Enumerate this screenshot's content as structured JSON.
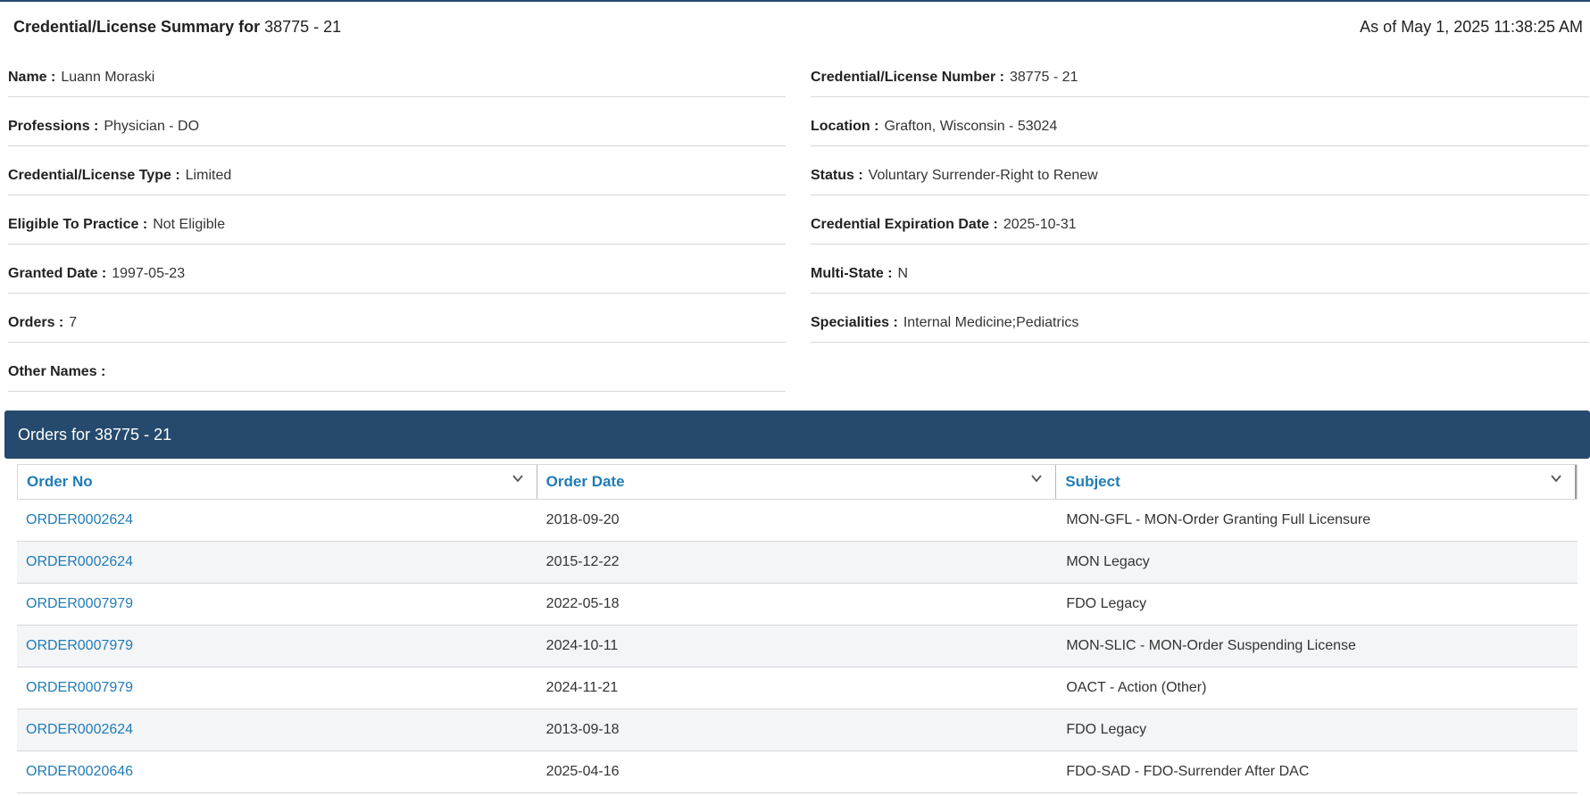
{
  "summary": {
    "title_label": "Credential/License Summary for",
    "title_value": "38775 - 21",
    "as_of": "As of May 1, 2025 11:38:25 AM"
  },
  "fields_left": [
    {
      "label": "Name :",
      "value": "Luann Moraski"
    },
    {
      "label": "Professions :",
      "value": "Physician - DO"
    },
    {
      "label": "Credential/License Type :",
      "value": "Limited"
    },
    {
      "label": "Eligible To Practice :",
      "value": "Not Eligible"
    },
    {
      "label": "Granted Date :",
      "value": "1997-05-23"
    },
    {
      "label": "Orders :",
      "value": "7"
    },
    {
      "label": "Other Names :",
      "value": ""
    }
  ],
  "fields_right": [
    {
      "label": "Credential/License Number :",
      "value": "38775 - 21"
    },
    {
      "label": "Location :",
      "value": "Grafton, Wisconsin - 53024"
    },
    {
      "label": "Status :",
      "value": "Voluntary Surrender-Right to Renew"
    },
    {
      "label": "Credential Expiration Date :",
      "value": "2025-10-31"
    },
    {
      "label": "Multi-State :",
      "value": "N"
    },
    {
      "label": "Specialities :",
      "value": "Internal Medicine;Pediatrics"
    }
  ],
  "orders": {
    "header": "Orders for 38775 - 21",
    "columns": [
      "Order No",
      "Order Date",
      "Subject"
    ],
    "rows": [
      [
        "ORDER0002624",
        "2018-09-20",
        "MON-GFL - MON-Order Granting Full Licensure"
      ],
      [
        "ORDER0002624",
        "2015-12-22",
        "MON Legacy"
      ],
      [
        "ORDER0007979",
        "2022-05-18",
        "FDO Legacy"
      ],
      [
        "ORDER0007979",
        "2024-10-11",
        "MON-SLIC - MON-Order Suspending License"
      ],
      [
        "ORDER0007979",
        "2024-11-21",
        "OACT - Action (Other)"
      ],
      [
        "ORDER0002624",
        "2013-09-18",
        "FDO Legacy"
      ],
      [
        "ORDER0020646",
        "2025-04-16",
        "FDO-SAD - FDO-Surrender After DAC"
      ]
    ]
  },
  "colors": {
    "header_bar": "#254a6d",
    "link": "#1f7cb7"
  }
}
